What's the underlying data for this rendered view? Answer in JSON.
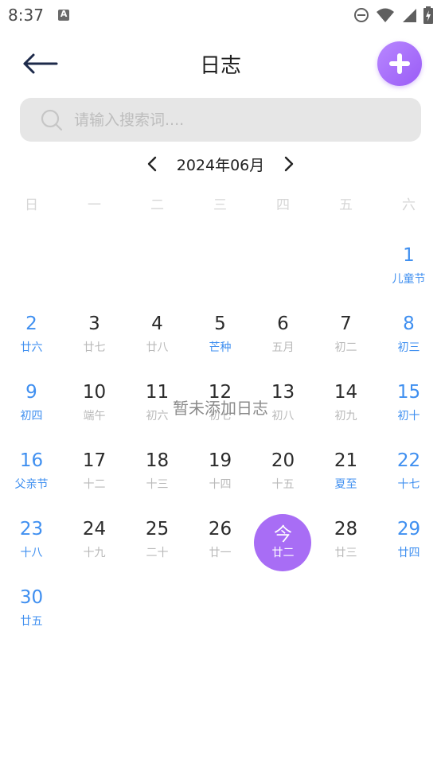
{
  "status_bar": {
    "time": "8:37",
    "icons": [
      "notification-a-icon",
      "do-not-disturb-icon",
      "wifi-icon",
      "signal-icon",
      "battery-icon"
    ]
  },
  "header": {
    "title": "日志",
    "back_icon": "arrow-left-icon",
    "add_icon": "plus-icon"
  },
  "search": {
    "placeholder": "请输入搜索词....",
    "value": ""
  },
  "calendar": {
    "month_label": "2024年06月",
    "weekdays": [
      "日",
      "一",
      "二",
      "三",
      "四",
      "五",
      "六"
    ],
    "days": [
      {
        "day": "1",
        "lunar": "儿童节",
        "festival": true
      },
      {
        "day": "2",
        "lunar": "廿六"
      },
      {
        "day": "3",
        "lunar": "廿七"
      },
      {
        "day": "4",
        "lunar": "廿八"
      },
      {
        "day": "5",
        "lunar": "芒种",
        "festival": true
      },
      {
        "day": "6",
        "lunar": "五月"
      },
      {
        "day": "7",
        "lunar": "初二"
      },
      {
        "day": "8",
        "lunar": "初三"
      },
      {
        "day": "9",
        "lunar": "初四"
      },
      {
        "day": "10",
        "lunar": "端午"
      },
      {
        "day": "11",
        "lunar": "初六"
      },
      {
        "day": "12",
        "lunar": "初七"
      },
      {
        "day": "13",
        "lunar": "初八"
      },
      {
        "day": "14",
        "lunar": "初九"
      },
      {
        "day": "15",
        "lunar": "初十"
      },
      {
        "day": "16",
        "lunar": "父亲节",
        "festival": true
      },
      {
        "day": "17",
        "lunar": "十二"
      },
      {
        "day": "18",
        "lunar": "十三"
      },
      {
        "day": "19",
        "lunar": "十四"
      },
      {
        "day": "20",
        "lunar": "十五"
      },
      {
        "day": "21",
        "lunar": "夏至",
        "festival": true
      },
      {
        "day": "22",
        "lunar": "十七"
      },
      {
        "day": "23",
        "lunar": "十八"
      },
      {
        "day": "24",
        "lunar": "十九"
      },
      {
        "day": "25",
        "lunar": "二十"
      },
      {
        "day": "26",
        "lunar": "廿一"
      },
      {
        "day": "今",
        "lunar": "廿二",
        "today": true
      },
      {
        "day": "28",
        "lunar": "廿三"
      },
      {
        "day": "29",
        "lunar": "廿四"
      },
      {
        "day": "30",
        "lunar": "廿五"
      }
    ],
    "first_weekday_index": 6
  },
  "empty_message": "暂未添加日志",
  "colors": {
    "accent_purple": "#a86df5",
    "weekend_blue": "#3f8ff0",
    "muted_text": "#b9b9b9"
  }
}
